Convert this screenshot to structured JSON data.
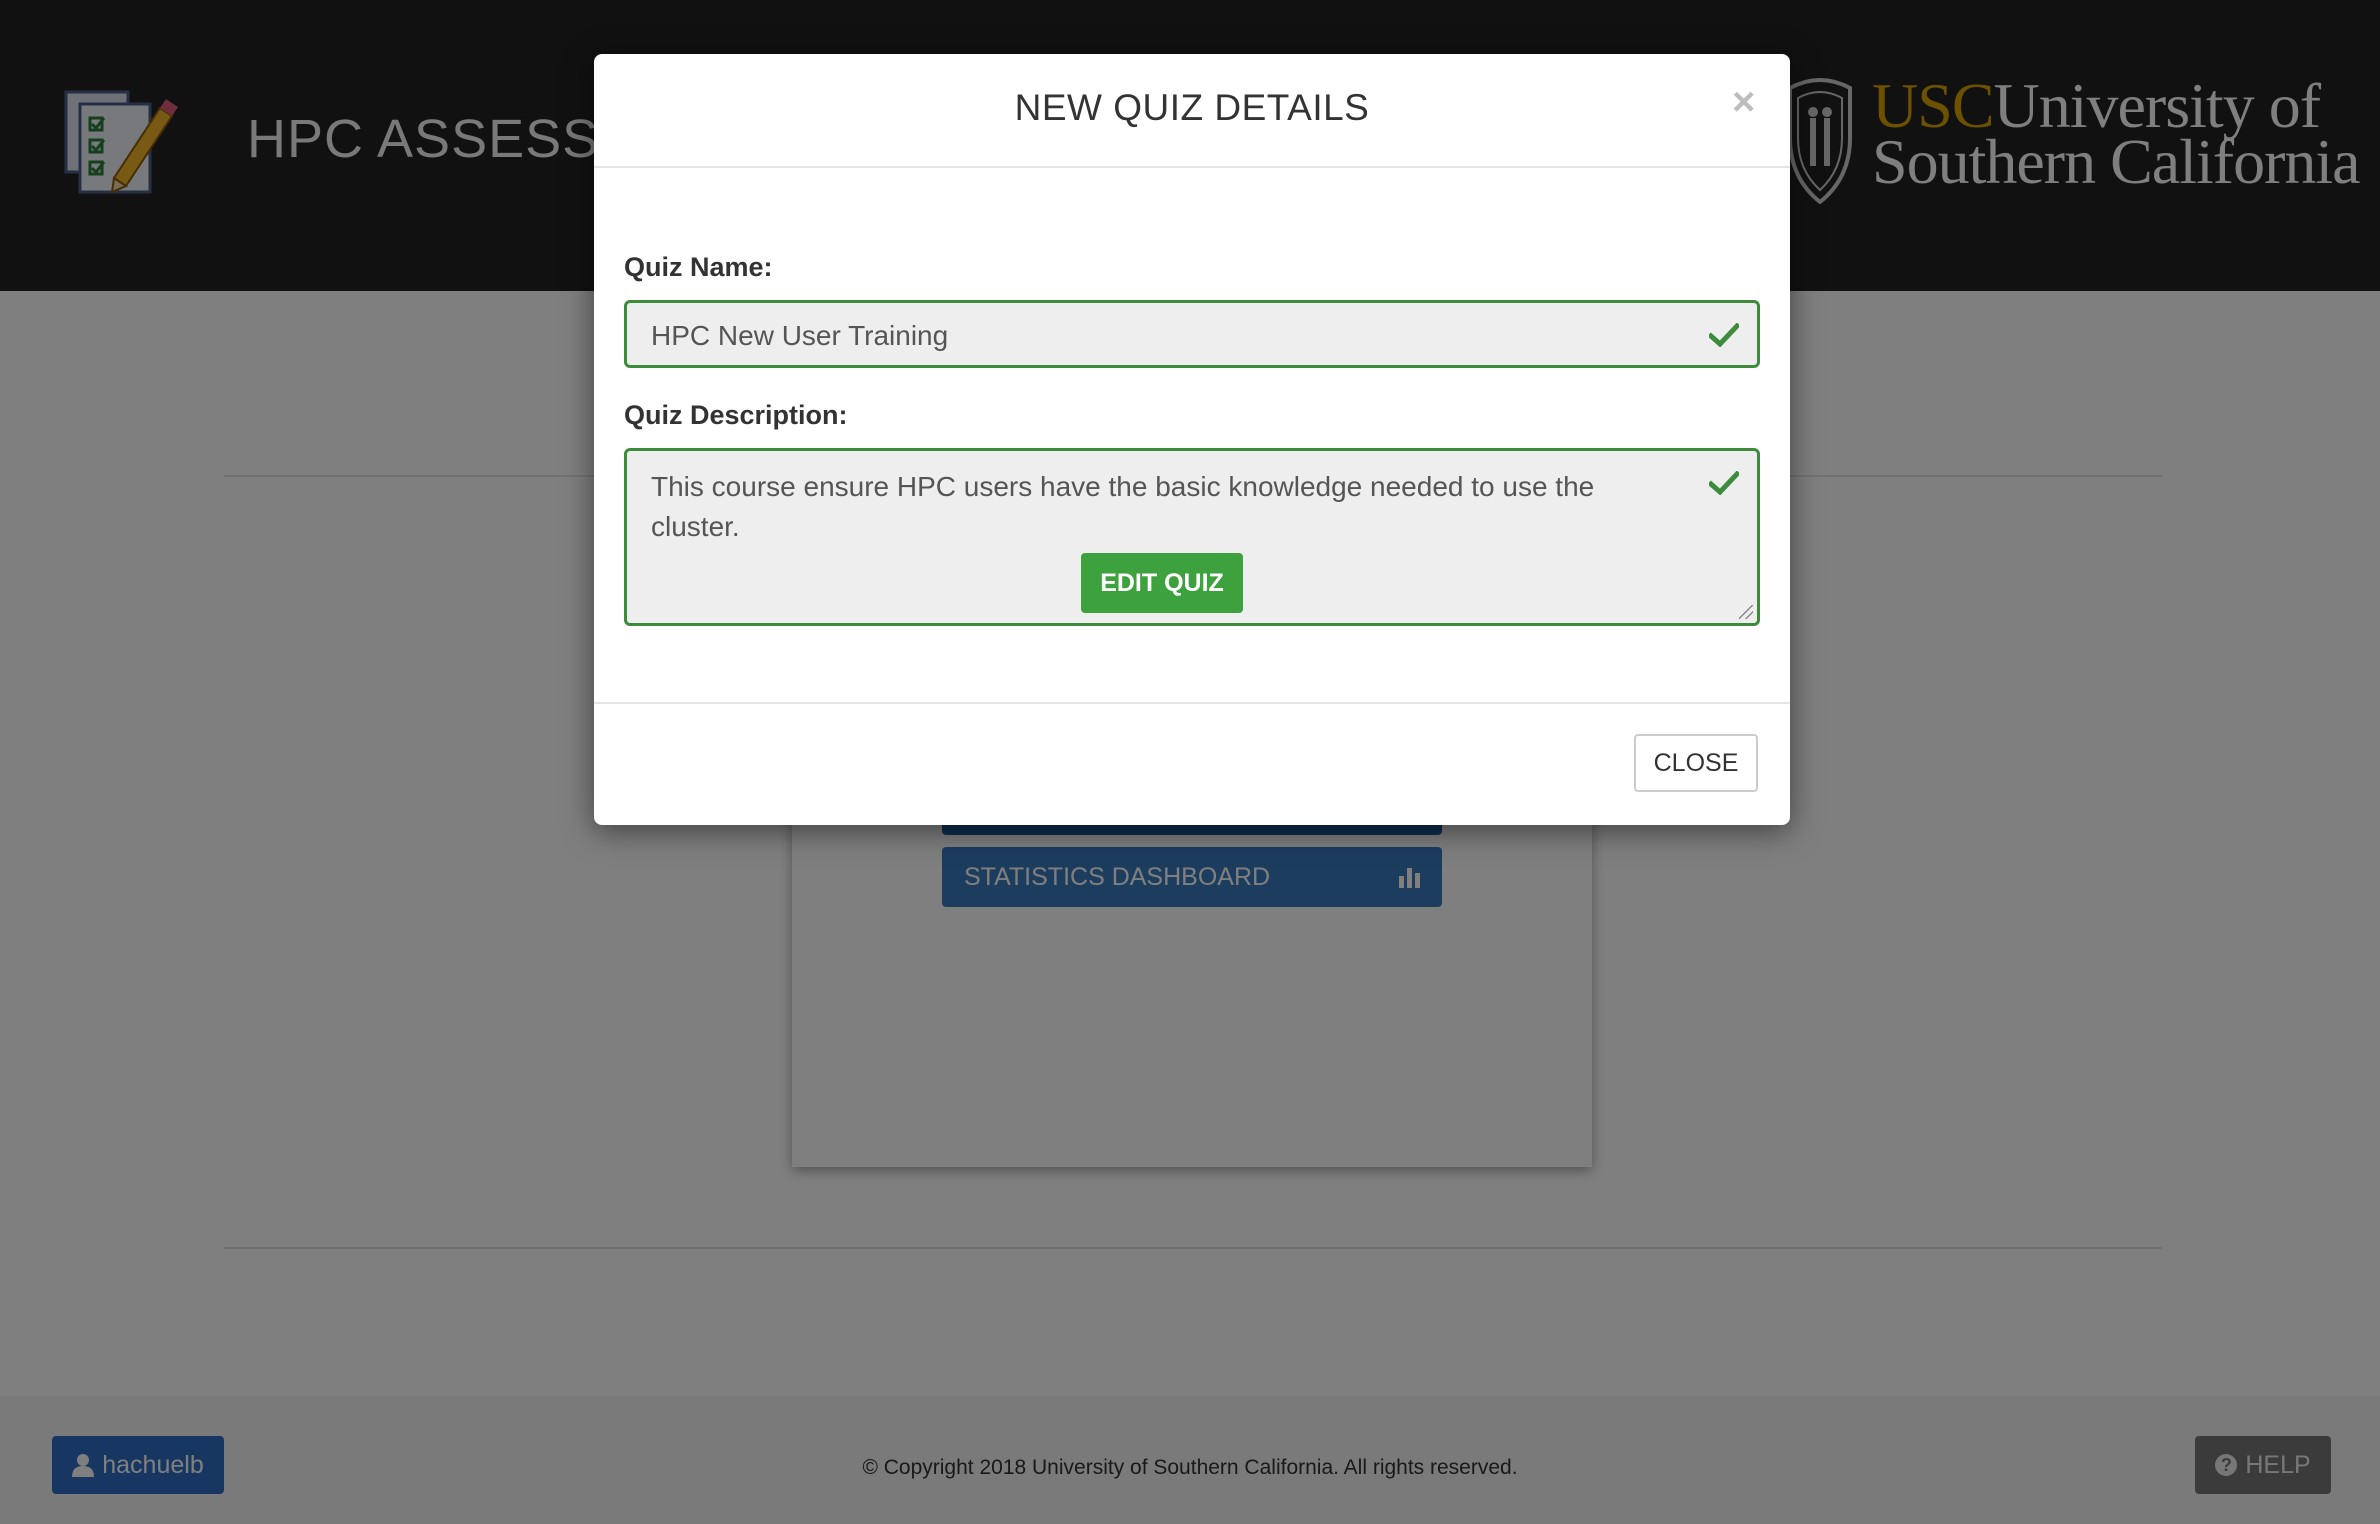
{
  "header": {
    "app_title": "HPC ASSESSMENT",
    "logo_abbr": "USC",
    "logo_line1": "University of",
    "logo_line2": "Southern California"
  },
  "main": {
    "buttons": [
      {
        "label": "",
        "icon": "none"
      },
      {
        "label": "STATISTICS DASHBOARD",
        "icon": "bar-chart-icon"
      }
    ]
  },
  "modal": {
    "title": "NEW QUIZ DETAILS",
    "close_x": "×",
    "name_label": "Quiz Name:",
    "name_value": "HPC New User Training",
    "description_label": "Quiz Description:",
    "description_value": "This course ensure HPC users have the basic knowledge needed to use the cluster.",
    "edit_button": "EDIT QUIZ",
    "close_button": "CLOSE"
  },
  "footer": {
    "user_label": "hachuelb",
    "copyright": "© Copyright 2018 University of Southern California. All rights reserved.",
    "help_label": "HELP"
  },
  "colors": {
    "header_bg": "#222222",
    "usc_gold": "#d9a300",
    "primary_blue": "#2e6fc4",
    "success_green": "#3da13d",
    "valid_border": "#3c8c3c"
  }
}
